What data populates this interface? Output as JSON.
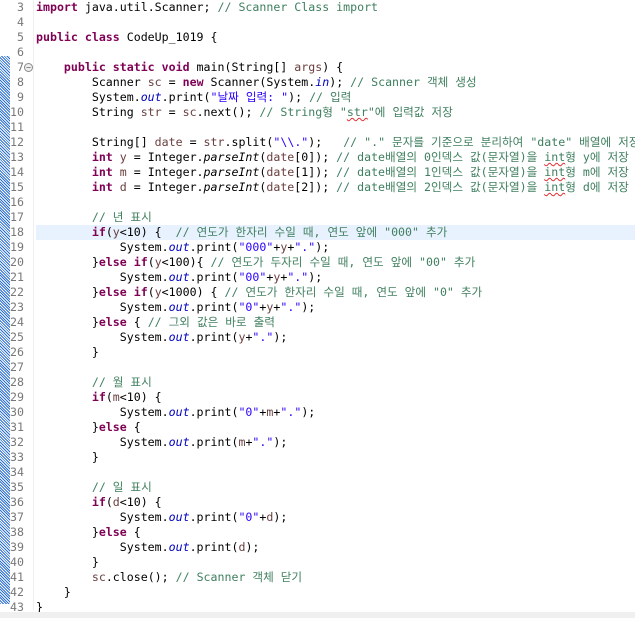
{
  "editor": {
    "highlighted_line": 18,
    "folded_marker_line": 7,
    "lines": [
      {
        "n": "3",
        "t": [
          [
            "k",
            "import"
          ],
          [
            "p",
            " java.util.Scanner; "
          ],
          [
            "c",
            "// Scanner Class import"
          ]
        ]
      },
      {
        "n": "4",
        "t": []
      },
      {
        "n": "5",
        "t": [
          [
            "k",
            "public class"
          ],
          [
            "p",
            " CodeUp_1019 {"
          ]
        ]
      },
      {
        "n": "6",
        "t": []
      },
      {
        "n": "7",
        "t": [
          [
            "p",
            "    "
          ],
          [
            "k",
            "public static void"
          ],
          [
            "p",
            " main(String[] "
          ],
          [
            "v",
            "args"
          ],
          [
            "p",
            ") {"
          ]
        ]
      },
      {
        "n": "8",
        "t": [
          [
            "p",
            "        Scanner "
          ],
          [
            "v",
            "sc"
          ],
          [
            "p",
            " = "
          ],
          [
            "k",
            "new"
          ],
          [
            "p",
            " Scanner(System."
          ],
          [
            "f",
            "in"
          ],
          [
            "p",
            "); "
          ],
          [
            "c",
            "// Scanner 객체 생성"
          ]
        ]
      },
      {
        "n": "9",
        "t": [
          [
            "p",
            "        System."
          ],
          [
            "f",
            "out"
          ],
          [
            "p",
            ".print("
          ],
          [
            "s",
            "\"날짜 입력: \""
          ],
          [
            "p",
            "); "
          ],
          [
            "c",
            "// 입력"
          ]
        ]
      },
      {
        "n": "10",
        "t": [
          [
            "p",
            "        String "
          ],
          [
            "v",
            "str"
          ],
          [
            "p",
            " = "
          ],
          [
            "v",
            "sc"
          ],
          [
            "p",
            ".next(); "
          ],
          [
            "c",
            "// String형 \""
          ],
          [
            "csq",
            "str"
          ],
          [
            "c",
            "\"에 입력값 저장"
          ]
        ]
      },
      {
        "n": "11",
        "t": []
      },
      {
        "n": "12",
        "t": [
          [
            "p",
            "        String[] "
          ],
          [
            "v",
            "date"
          ],
          [
            "p",
            " = "
          ],
          [
            "v",
            "str"
          ],
          [
            "p",
            ".split("
          ],
          [
            "s",
            "\"\\\\.\""
          ],
          [
            "p",
            ");   "
          ],
          [
            "c",
            "// \".\" 문자를 기준으로 분리하여 \"date\" 배열에 저장"
          ]
        ]
      },
      {
        "n": "13",
        "t": [
          [
            "k",
            "        int"
          ],
          [
            "p",
            " "
          ],
          [
            "v",
            "y"
          ],
          [
            "p",
            " = Integer."
          ],
          [
            "m",
            "parseInt"
          ],
          [
            "p",
            "("
          ],
          [
            "v",
            "date"
          ],
          [
            "p",
            "[0]); "
          ],
          [
            "c",
            "// date배열의 0인덱스 값(문자열)을 "
          ],
          [
            "csq",
            "int"
          ],
          [
            "c",
            "형 y에 저장"
          ]
        ]
      },
      {
        "n": "14",
        "t": [
          [
            "k",
            "        int"
          ],
          [
            "p",
            " "
          ],
          [
            "v",
            "m"
          ],
          [
            "p",
            " = Integer."
          ],
          [
            "m",
            "parseInt"
          ],
          [
            "p",
            "("
          ],
          [
            "v",
            "date"
          ],
          [
            "p",
            "[1]); "
          ],
          [
            "c",
            "// date배열의 1인덱스 값(문자열)을 "
          ],
          [
            "csq",
            "int"
          ],
          [
            "c",
            "형 m에 저장"
          ]
        ]
      },
      {
        "n": "15",
        "t": [
          [
            "k",
            "        int"
          ],
          [
            "p",
            " "
          ],
          [
            "v",
            "d"
          ],
          [
            "p",
            " = Integer."
          ],
          [
            "m",
            "parseInt"
          ],
          [
            "p",
            "("
          ],
          [
            "v",
            "date"
          ],
          [
            "p",
            "[2]); "
          ],
          [
            "c",
            "// date배열의 2인덱스 값(문자열)을 "
          ],
          [
            "csq",
            "int"
          ],
          [
            "c",
            "형 d에 저장"
          ]
        ]
      },
      {
        "n": "16",
        "t": []
      },
      {
        "n": "17",
        "t": [
          [
            "c",
            "        // 년 표시"
          ]
        ]
      },
      {
        "n": "18",
        "t": [
          [
            "k",
            "        if"
          ],
          [
            "p",
            "("
          ],
          [
            "v",
            "y"
          ],
          [
            "p",
            "<10) {  "
          ],
          [
            "c",
            "// 연도가 한자리 수일 때, 연도 앞에 \"000\" 추가"
          ]
        ]
      },
      {
        "n": "19",
        "t": [
          [
            "p",
            "            System."
          ],
          [
            "f",
            "out"
          ],
          [
            "p",
            ".print("
          ],
          [
            "s",
            "\"000\""
          ],
          [
            "p",
            "+"
          ],
          [
            "v",
            "y"
          ],
          [
            "p",
            "+"
          ],
          [
            "s",
            "\".\""
          ],
          [
            "p",
            ");"
          ]
        ]
      },
      {
        "n": "20",
        "t": [
          [
            "p",
            "        }"
          ],
          [
            "k",
            "else if"
          ],
          [
            "p",
            "("
          ],
          [
            "v",
            "y"
          ],
          [
            "p",
            "<100){ "
          ],
          [
            "c",
            "// 연도가 두자리 수일 때, 연도 앞에 \"00\" 추가"
          ]
        ]
      },
      {
        "n": "21",
        "t": [
          [
            "p",
            "            System."
          ],
          [
            "f",
            "out"
          ],
          [
            "p",
            ".print("
          ],
          [
            "s",
            "\"00\""
          ],
          [
            "p",
            "+"
          ],
          [
            "v",
            "y"
          ],
          [
            "p",
            "+"
          ],
          [
            "s",
            "\".\""
          ],
          [
            "p",
            ");"
          ]
        ]
      },
      {
        "n": "22",
        "t": [
          [
            "p",
            "        }"
          ],
          [
            "k",
            "else if"
          ],
          [
            "p",
            "("
          ],
          [
            "v",
            "y"
          ],
          [
            "p",
            "<1000) { "
          ],
          [
            "c",
            "// 연도가 한자리 수일 때, 연도 앞에 \"0\" 추가"
          ]
        ]
      },
      {
        "n": "23",
        "t": [
          [
            "p",
            "            System."
          ],
          [
            "f",
            "out"
          ],
          [
            "p",
            ".print("
          ],
          [
            "s",
            "\"0\""
          ],
          [
            "p",
            "+"
          ],
          [
            "v",
            "y"
          ],
          [
            "p",
            "+"
          ],
          [
            "s",
            "\".\""
          ],
          [
            "p",
            ");"
          ]
        ]
      },
      {
        "n": "24",
        "t": [
          [
            "p",
            "        }"
          ],
          [
            "k",
            "else"
          ],
          [
            "p",
            " { "
          ],
          [
            "c",
            "// 그외 값은 바로 출력"
          ]
        ]
      },
      {
        "n": "25",
        "t": [
          [
            "p",
            "            System."
          ],
          [
            "f",
            "out"
          ],
          [
            "p",
            ".print("
          ],
          [
            "v",
            "y"
          ],
          [
            "p",
            "+"
          ],
          [
            "s",
            "\".\""
          ],
          [
            "p",
            ");"
          ]
        ]
      },
      {
        "n": "26",
        "t": [
          [
            "p",
            "        }"
          ]
        ]
      },
      {
        "n": "27",
        "t": []
      },
      {
        "n": "28",
        "t": [
          [
            "c",
            "        // 월 표시"
          ]
        ]
      },
      {
        "n": "29",
        "t": [
          [
            "k",
            "        if"
          ],
          [
            "p",
            "("
          ],
          [
            "v",
            "m"
          ],
          [
            "p",
            "<10) {"
          ]
        ]
      },
      {
        "n": "30",
        "t": [
          [
            "p",
            "            System."
          ],
          [
            "f",
            "out"
          ],
          [
            "p",
            ".print("
          ],
          [
            "s",
            "\"0\""
          ],
          [
            "p",
            "+"
          ],
          [
            "v",
            "m"
          ],
          [
            "p",
            "+"
          ],
          [
            "s",
            "\".\""
          ],
          [
            "p",
            ");"
          ]
        ]
      },
      {
        "n": "31",
        "t": [
          [
            "p",
            "        }"
          ],
          [
            "k",
            "else"
          ],
          [
            "p",
            " {"
          ]
        ]
      },
      {
        "n": "32",
        "t": [
          [
            "p",
            "            System."
          ],
          [
            "f",
            "out"
          ],
          [
            "p",
            ".print("
          ],
          [
            "v",
            "m"
          ],
          [
            "p",
            "+"
          ],
          [
            "s",
            "\".\""
          ],
          [
            "p",
            ");"
          ]
        ]
      },
      {
        "n": "33",
        "t": [
          [
            "p",
            "        }"
          ]
        ]
      },
      {
        "n": "34",
        "t": []
      },
      {
        "n": "35",
        "t": [
          [
            "c",
            "        // 일 표시"
          ]
        ]
      },
      {
        "n": "36",
        "t": [
          [
            "k",
            "        if"
          ],
          [
            "p",
            "("
          ],
          [
            "v",
            "d"
          ],
          [
            "p",
            "<10) {"
          ]
        ]
      },
      {
        "n": "37",
        "t": [
          [
            "p",
            "            System."
          ],
          [
            "f",
            "out"
          ],
          [
            "p",
            ".print("
          ],
          [
            "s",
            "\"0\""
          ],
          [
            "p",
            "+"
          ],
          [
            "v",
            "d"
          ],
          [
            "p",
            ");"
          ]
        ]
      },
      {
        "n": "38",
        "t": [
          [
            "p",
            "        }"
          ],
          [
            "k",
            "else"
          ],
          [
            "p",
            " {"
          ]
        ]
      },
      {
        "n": "39",
        "t": [
          [
            "p",
            "            System."
          ],
          [
            "f",
            "out"
          ],
          [
            "p",
            ".print("
          ],
          [
            "v",
            "d"
          ],
          [
            "p",
            ");"
          ]
        ]
      },
      {
        "n": "40",
        "t": [
          [
            "p",
            "        }"
          ]
        ]
      },
      {
        "n": "41",
        "t": [
          [
            "p",
            "        "
          ],
          [
            "v",
            "sc"
          ],
          [
            "p",
            ".close(); "
          ],
          [
            "c",
            "// Scanner 객체 닫기"
          ]
        ]
      },
      {
        "n": "42",
        "t": [
          [
            "p",
            "    }"
          ]
        ]
      },
      {
        "n": "43",
        "t": [
          [
            "p",
            "}"
          ]
        ]
      }
    ]
  },
  "colors": {
    "keyword": "#7f0055",
    "comment": "#3f7f5f",
    "string": "#2a00ff",
    "field": "#0000c0",
    "local": "#6a3e3e",
    "current_line": "#e8f2fe"
  }
}
